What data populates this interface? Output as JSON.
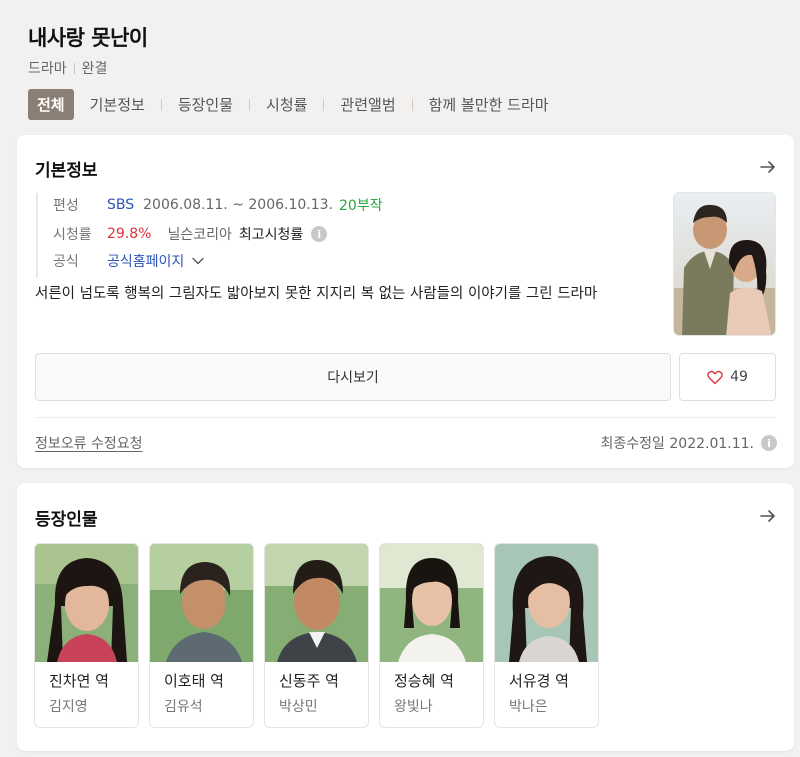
{
  "header": {
    "title": "내사랑 못난이",
    "genre": "드라마",
    "status": "완결",
    "tabs": [
      {
        "label": "전체"
      },
      {
        "label": "기본정보"
      },
      {
        "label": "등장인물"
      },
      {
        "label": "시청률"
      },
      {
        "label": "관련앨범"
      },
      {
        "label": "함께 볼만한 드라마"
      }
    ]
  },
  "basic_info": {
    "title": "기본정보",
    "broadcast_label": "편성",
    "channel": "SBS",
    "period": "2006.08.11. ~ 2006.10.13.",
    "episodes": "20부작",
    "rating_label": "시청률",
    "rating_value": "29.8%",
    "rating_source": "닐슨코리아",
    "rating_desc": "최고시청률",
    "official_label": "공식",
    "official_link": "공식홈페이지",
    "description": "서른이 넘도록 행복의 그림자도 밟아보지 못한 지지리 복 없는 사람들의 이야기를 그린 드라마",
    "rewatch_label": "다시보기",
    "like_count": "49",
    "report_label": "정보오류 수정요청",
    "updated_label": "최종수정일 2022.01.11."
  },
  "cast": {
    "title": "등장인물",
    "members": [
      {
        "role": "진차연 역",
        "actor": "김지영"
      },
      {
        "role": "이호태 역",
        "actor": "김유석"
      },
      {
        "role": "신동주 역",
        "actor": "박상민"
      },
      {
        "role": "정승혜 역",
        "actor": "왕빛나"
      },
      {
        "role": "서유경 역",
        "actor": "박나은"
      }
    ]
  },
  "colors": {
    "active_tab": "#8a7e75",
    "link_blue": "#2b55b8",
    "episodes_green": "#2aa640",
    "rating_red": "#e0333c",
    "heart": "#e0333c"
  },
  "icons": [
    "arrow-right-icon",
    "info-icon",
    "chevron-down-icon",
    "heart-icon"
  ]
}
